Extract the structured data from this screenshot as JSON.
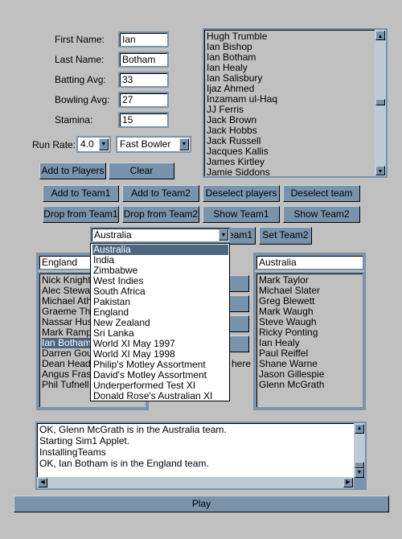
{
  "form": {
    "first_name_label": "First Name:",
    "first_name": "Ian",
    "last_name_label": "Last Name:",
    "last_name": "Botham",
    "batting_label": "Batting Avg:",
    "batting": "33",
    "bowling_label": "Bowling Avg:",
    "bowling": "27",
    "stamina_label": "Stamina:",
    "stamina": "15",
    "run_rate_label": "Run Rate:",
    "run_rate": "4.0",
    "role": "Fast Bowler",
    "add_players": "Add to Players",
    "clear": "Clear"
  },
  "players": [
    "Hugh Trumble",
    "Ian Bishop",
    "Ian Botham",
    "Ian Healy",
    "Ian Salisbury",
    "Ijaz Ahmed",
    "Inzamam ul-Haq",
    "JJ Ferris",
    "Jack Brown",
    "Jack Hobbs",
    "Jack Russell",
    "Jacques Kallis",
    "James Kirtley",
    "Jamie Siddons"
  ],
  "buttons": {
    "add_team1": "Add to Team1",
    "add_team2": "Add to Team2",
    "deselect_players": "Deselect players",
    "deselect_team": "Deselect team",
    "drop_team1": "Drop from Team1",
    "drop_team2": "Drop from Team2",
    "show_team1": "Show Team1",
    "show_team2": "Show Team2",
    "set_team1": "eam1",
    "set_team2": "Set Team2",
    "here": "here",
    "play": "Play"
  },
  "team_combo": {
    "selected": "Australia",
    "options": [
      "Australia",
      "India",
      "Zimbabwe",
      "West Indies",
      "South Africa",
      "Pakistan",
      "England",
      "New Zealand",
      "Sri Lanka",
      "World XI May 1997",
      "World XI May 1998",
      "Philip's Motley Assortment",
      "David's Motley Assortment",
      "Underperformed Test XI",
      "Donald Rose's Australian XI"
    ]
  },
  "team1": {
    "name": "England",
    "players": [
      "Nick Knight",
      "Alec Stewart",
      "Michael Atherton",
      "Graeme Thorpe",
      "Nassar Hussain",
      "Mark Ramprakash",
      "Ian Botham",
      "Darren Gough",
      "Dean Headley",
      "Angus Fraser",
      "Phil Tufnell"
    ],
    "selected": "Ian Botham"
  },
  "team2": {
    "name": "Australia",
    "players": [
      "Mark Taylor",
      "Michael Slater",
      "Greg Blewett",
      "Mark Waugh",
      "Steve Waugh",
      "Ricky Ponting",
      "Ian Healy",
      "Paul Reiffel",
      "Shane Warne",
      "Jason Gillespie",
      "Glenn McGrath"
    ]
  },
  "log": [
    "OK, Glenn McGrath is in the Australia team.",
    "Starting Sim1 Applet.",
    "InstallingTeams",
    "OK, Ian Botham is in the England team."
  ]
}
